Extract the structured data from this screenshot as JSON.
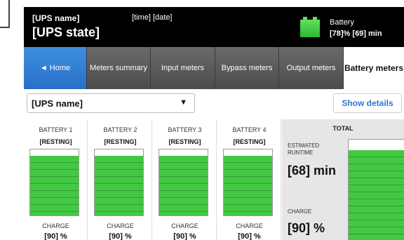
{
  "header": {
    "ups_name": "[UPS name]",
    "time": "[time]",
    "date": "[date]",
    "ups_state": "[UPS state]",
    "battery_label": "Battery",
    "battery_percent": "[78]%",
    "battery_runtime": "[69] min",
    "battery_icon": "battery-icon"
  },
  "tabs": [
    {
      "label": "◄ Home"
    },
    {
      "label": "Meters summary"
    },
    {
      "label": "Input meters"
    },
    {
      "label": "Bypass meters"
    },
    {
      "label": "Output meters"
    },
    {
      "label": "Battery meters"
    }
  ],
  "controls": {
    "ups_select_value": "[UPS name]",
    "ups_select_arrow": "▼",
    "show_details_label": "Show details"
  },
  "batteries": [
    {
      "title": "BATTERY 1",
      "state": "[RESTING]",
      "charge_label": "CHARGE",
      "charge_value": "[90] %",
      "fill": 0.9
    },
    {
      "title": "BATTERY 2",
      "state": "[RESTING]",
      "charge_label": "CHARGE",
      "charge_value": "[90] %",
      "fill": 0.9
    },
    {
      "title": "BATTERY 3",
      "state": "[RESTING]",
      "charge_label": "CHARGE",
      "charge_value": "[90] %",
      "fill": 0.9
    },
    {
      "title": "BATTERY 4",
      "state": "[RESTING]",
      "charge_label": "CHARGE",
      "charge_value": "[90] %",
      "fill": 0.9
    }
  ],
  "total": {
    "title": "TOTAL",
    "runtime_label": "ESTIMATED RUNTIME",
    "runtime_value": "[68] min",
    "charge_label": "CHARGE",
    "charge_value": "[90] %",
    "fill": 0.9
  },
  "colors": {
    "accent_blue": "#2a78cf",
    "battery_green": "#44c844",
    "header_bg": "#000000"
  }
}
